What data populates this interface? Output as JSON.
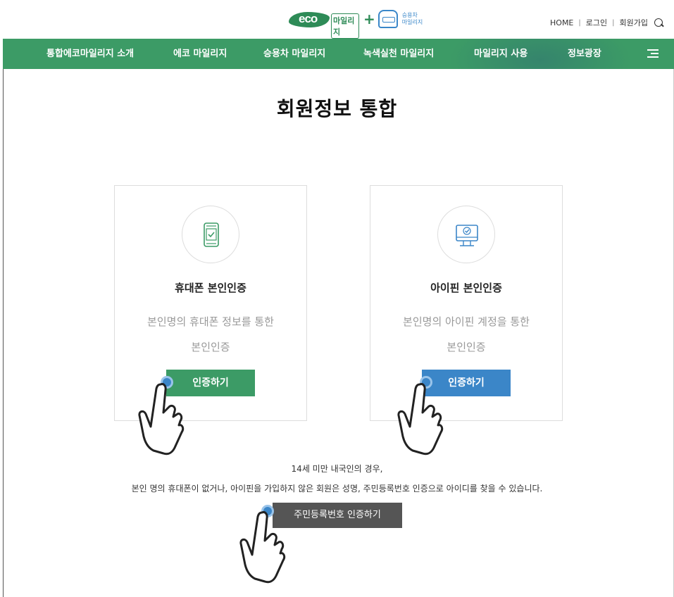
{
  "header": {
    "logo": {
      "eco": "eco",
      "mileage": "마일리지",
      "plus": "+",
      "car_line1": "승용차",
      "car_line2": "마일리지"
    },
    "util": {
      "home": "HOME",
      "sep": "|",
      "login": "로그인",
      "signup": "회원가입"
    }
  },
  "gnb": {
    "items": [
      "통합에코마일리지 소개",
      "에코 마일리지",
      "승용차 마일리지",
      "녹색실천 마일리지",
      "마일리지 사용",
      "정보광장"
    ],
    "bg_color": "#3c9b66"
  },
  "main": {
    "title": "회원정보 통합",
    "cards": [
      {
        "title": "휴대폰 본인인증",
        "desc_line1": "본인명의 휴대폰 정보를 통한",
        "desc_line2": "본인인증",
        "button": "인증하기",
        "icon": "mobile-check-icon",
        "color": "#3c9b66"
      },
      {
        "title": "아이핀 본인인증",
        "desc_line1": "본인명의 아이핀 계정을 통한",
        "desc_line2": "본인인증",
        "button": "인증하기",
        "icon": "monitor-check-icon",
        "color": "#3b86c8"
      }
    ],
    "notice_line1": "14세 미만 내국인의 경우,",
    "notice_line2": "본인 명의 휴대폰이 없거나, 아이핀을 가입하지 않은 회원은 성명, 주민등록번호 인증으로 아이디를 찾을 수 있습니다.",
    "resident_button": "주민등록번호 인증하기"
  }
}
